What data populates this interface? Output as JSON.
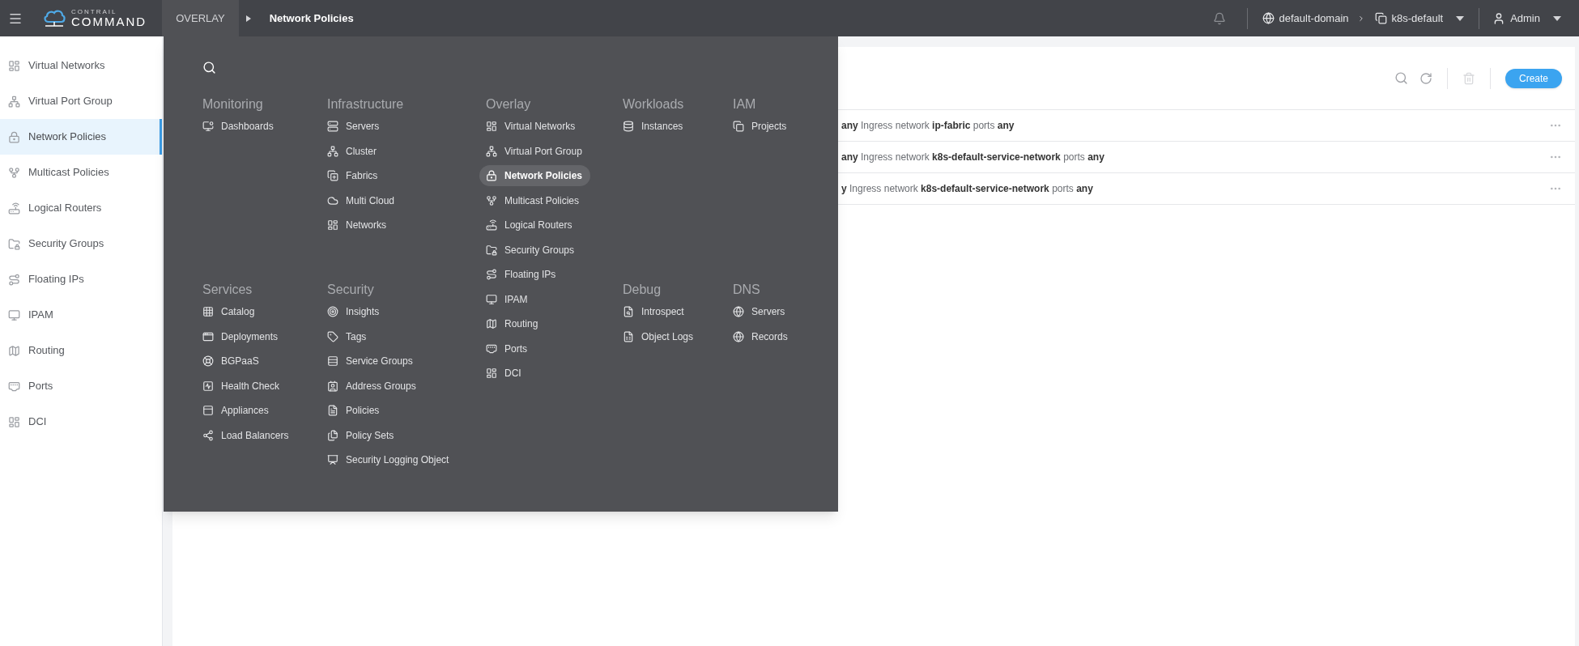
{
  "top_bar": {
    "logo": {
      "line_1": "CONTRAIL",
      "line_2": "COMMAND"
    },
    "breadcrumb": [
      {
        "label": "OVERLAY",
        "kind": "menu"
      },
      {
        "label": "Network Policies",
        "kind": "page"
      }
    ],
    "domain": "default-domain",
    "project": "k8s-default",
    "user": "Admin"
  },
  "sidebar": {
    "items": [
      {
        "label": "Virtual Networks",
        "selected": false
      },
      {
        "label": "Virtual Port Group",
        "selected": false
      },
      {
        "label": "Network Policies",
        "selected": true
      },
      {
        "label": "Multicast Policies",
        "selected": false
      },
      {
        "label": "Logical Routers",
        "selected": false
      },
      {
        "label": "Security Groups",
        "selected": false
      },
      {
        "label": "Floating IPs",
        "selected": false
      },
      {
        "label": "IPAM",
        "selected": false
      },
      {
        "label": "Routing",
        "selected": false
      },
      {
        "label": "Ports",
        "selected": false
      },
      {
        "label": "DCI",
        "selected": false
      }
    ]
  },
  "toolbar": {
    "create_button": "Create",
    "delete_disabled": true
  },
  "table": {
    "rows": [
      {
        "rule": "**any** Ingress network **ip-fabric** ports **any**"
      },
      {
        "rule": "**any** Ingress network **k8s-default-service-network** ports **any**"
      },
      {
        "rule": "**y** Ingress network **k8s-default-service-network** ports **any**"
      }
    ]
  },
  "menu": {
    "open": true,
    "columns": [
      {
        "sections": [
          {
            "title": "Monitoring",
            "items": [
              {
                "label": "Dashboards",
                "selected": false
              }
            ]
          },
          {
            "title": "Services",
            "items": [
              {
                "label": "Catalog",
                "selected": false
              },
              {
                "label": "Deployments",
                "selected": false
              },
              {
                "label": "BGPaaS",
                "selected": false
              },
              {
                "label": "Health Check",
                "selected": false
              },
              {
                "label": "Appliances",
                "selected": false
              },
              {
                "label": "Load Balancers",
                "selected": false
              }
            ]
          }
        ]
      },
      {
        "sections": [
          {
            "title": "Infrastructure",
            "items": [
              {
                "label": "Servers",
                "selected": false
              },
              {
                "label": "Cluster",
                "selected": false
              },
              {
                "label": "Fabrics",
                "selected": false
              },
              {
                "label": "Multi Cloud",
                "selected": false
              },
              {
                "label": "Networks",
                "selected": false
              }
            ]
          },
          {
            "title": "Security",
            "items": [
              {
                "label": "Insights",
                "selected": false
              },
              {
                "label": "Tags",
                "selected": false
              },
              {
                "label": "Service Groups",
                "selected": false
              },
              {
                "label": "Address Groups",
                "selected": false
              },
              {
                "label": "Policies",
                "selected": false
              },
              {
                "label": "Policy Sets",
                "selected": false
              },
              {
                "label": "Security Logging Object",
                "selected": false
              }
            ]
          }
        ]
      },
      {
        "sections": [
          {
            "title": "Overlay",
            "items": [
              {
                "label": "Virtual Networks",
                "selected": false
              },
              {
                "label": "Virtual Port Group",
                "selected": false
              },
              {
                "label": "Network Policies",
                "selected": true
              },
              {
                "label": "Multicast Policies",
                "selected": false
              },
              {
                "label": "Logical Routers",
                "selected": false
              },
              {
                "label": "Security Groups",
                "selected": false
              },
              {
                "label": "Floating IPs",
                "selected": false
              },
              {
                "label": "IPAM",
                "selected": false
              },
              {
                "label": "Routing",
                "selected": false
              },
              {
                "label": "Ports",
                "selected": false
              },
              {
                "label": "DCI",
                "selected": false
              }
            ]
          }
        ]
      },
      {
        "sections": [
          {
            "title": "Workloads",
            "items": [
              {
                "label": "Instances",
                "selected": false
              }
            ]
          },
          {
            "title": "Debug",
            "items": [
              {
                "label": "Introspect",
                "selected": false
              },
              {
                "label": "Object Logs",
                "selected": false
              }
            ]
          }
        ]
      },
      {
        "sections": [
          {
            "title": "IAM",
            "items": [
              {
                "label": "Projects",
                "selected": false
              }
            ]
          },
          {
            "title": "DNS",
            "items": [
              {
                "label": "Servers",
                "selected": false
              },
              {
                "label": "Records",
                "selected": false
              }
            ]
          }
        ]
      }
    ]
  }
}
